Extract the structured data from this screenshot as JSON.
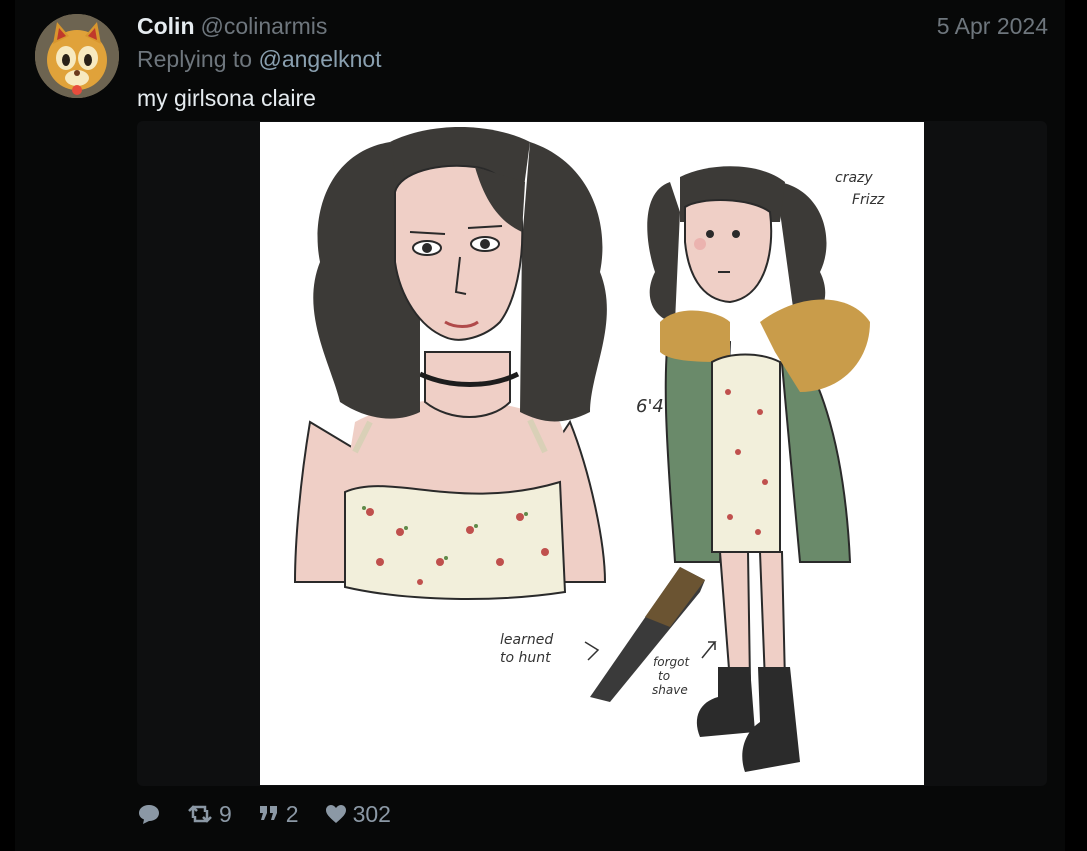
{
  "tweet": {
    "author_name": "Colin",
    "author_handle": "@colinarmis",
    "date": "5 Apr 2024",
    "reply_prefix": "Replying to",
    "reply_to": "@angelknot",
    "text": "my girlsona claire"
  },
  "artwork": {
    "annotation_frizz_1": "crazy",
    "annotation_frizz_2": "Frizz",
    "annotation_height": "6'4",
    "annotation_hunt_1": "learned",
    "annotation_hunt_2": "to hunt",
    "annotation_shave_1": "forgot",
    "annotation_shave_2": "to",
    "annotation_shave_3": "shave"
  },
  "actions": {
    "retweets": "9",
    "quotes": "2",
    "likes": "302"
  },
  "icons": {
    "reply": "speech-bubble-icon",
    "retweet": "retweet-icon",
    "quote": "quote-icon",
    "like": "heart-icon"
  }
}
